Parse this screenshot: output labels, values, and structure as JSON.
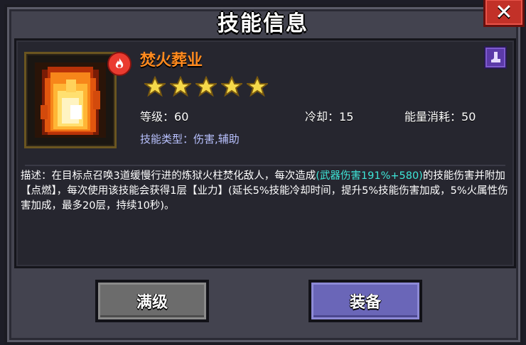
{
  "window": {
    "title": "技能信息",
    "close_label": "✕"
  },
  "skill": {
    "name": "焚火葬业",
    "stars": 5,
    "level_label": "等级：",
    "level_value": "60",
    "cooldown_label": "冷却：",
    "cooldown_value": "15",
    "energy_label": "能量消耗：",
    "energy_value": "50",
    "type_label": "技能类型：",
    "type_value": "伤害,辅助",
    "icon": "fire-pillar-icon",
    "element_icon": "fire-element-icon",
    "slot_icon": "boot-icon"
  },
  "description": {
    "prefix": "描述：在目标点召唤3道缓慢行进的炼狱火柱焚化敌人，每次造成",
    "highlight": "(武器伤害191%+580)",
    "suffix": "的技能伤害并附加【点燃】，每次使用该技能会获得1层【业力】(延长5%技能冷却时间，提升5%技能伤害加成，5%火属性伤害加成，最多20层，持续10秒)。"
  },
  "buttons": {
    "max_level": "满级",
    "equip": "装备"
  },
  "colors": {
    "name": "#ff8a1e",
    "highlight": "#3ee6d8",
    "star": "#f5d94a"
  }
}
